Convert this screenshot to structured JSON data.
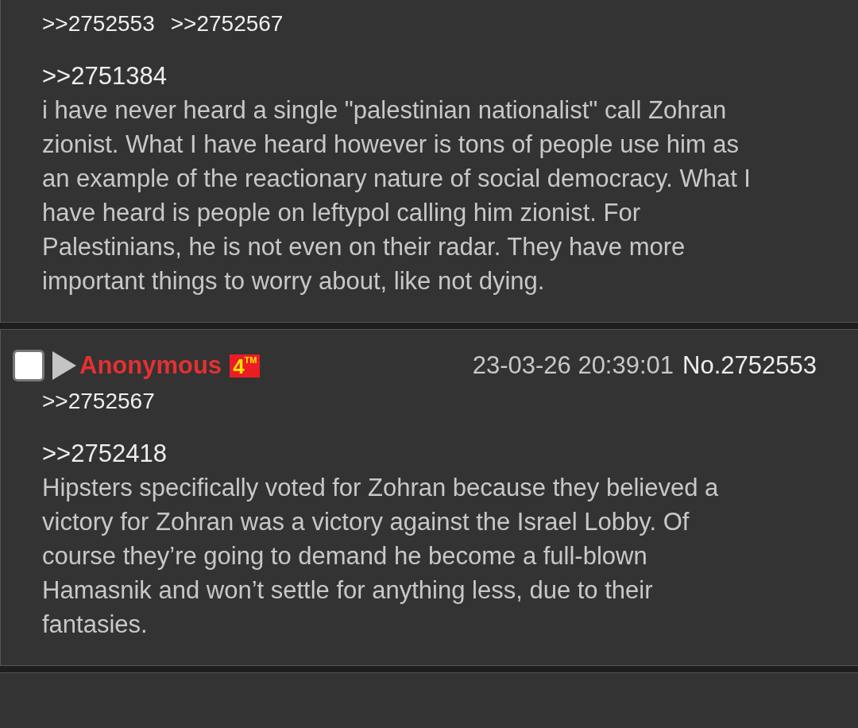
{
  "posts": [
    {
      "backlinks": [
        ">>2752553",
        ">>2752567"
      ],
      "quote": ">>2751384",
      "body": "i have never heard a single \"palestinian nationalist\" call Zohran zionist. What I have heard however is tons of people use him as an example of the reactionary nature of social democracy. What I have heard is people on leftypol calling him zionist. For Palestinians, he is not even on their radar. They have more important things to worry about, like not dying."
    },
    {
      "header": {
        "checked": false,
        "name": "Anonymous",
        "flag_text": "4",
        "flag_sup": "TM",
        "date": "23-03-26 20:39:01",
        "number": "No.2752553"
      },
      "backlinks": [
        ">>2752567"
      ],
      "quote": ">>2752418",
      "body": "Hipsters specifically voted for Zohran because they believed a victory for Zohran was a victory against the Israel Lobby. Of course they’re going to demand he become a full-blown Hamasnik and won’t settle for anything less, due to their fantasies."
    }
  ]
}
